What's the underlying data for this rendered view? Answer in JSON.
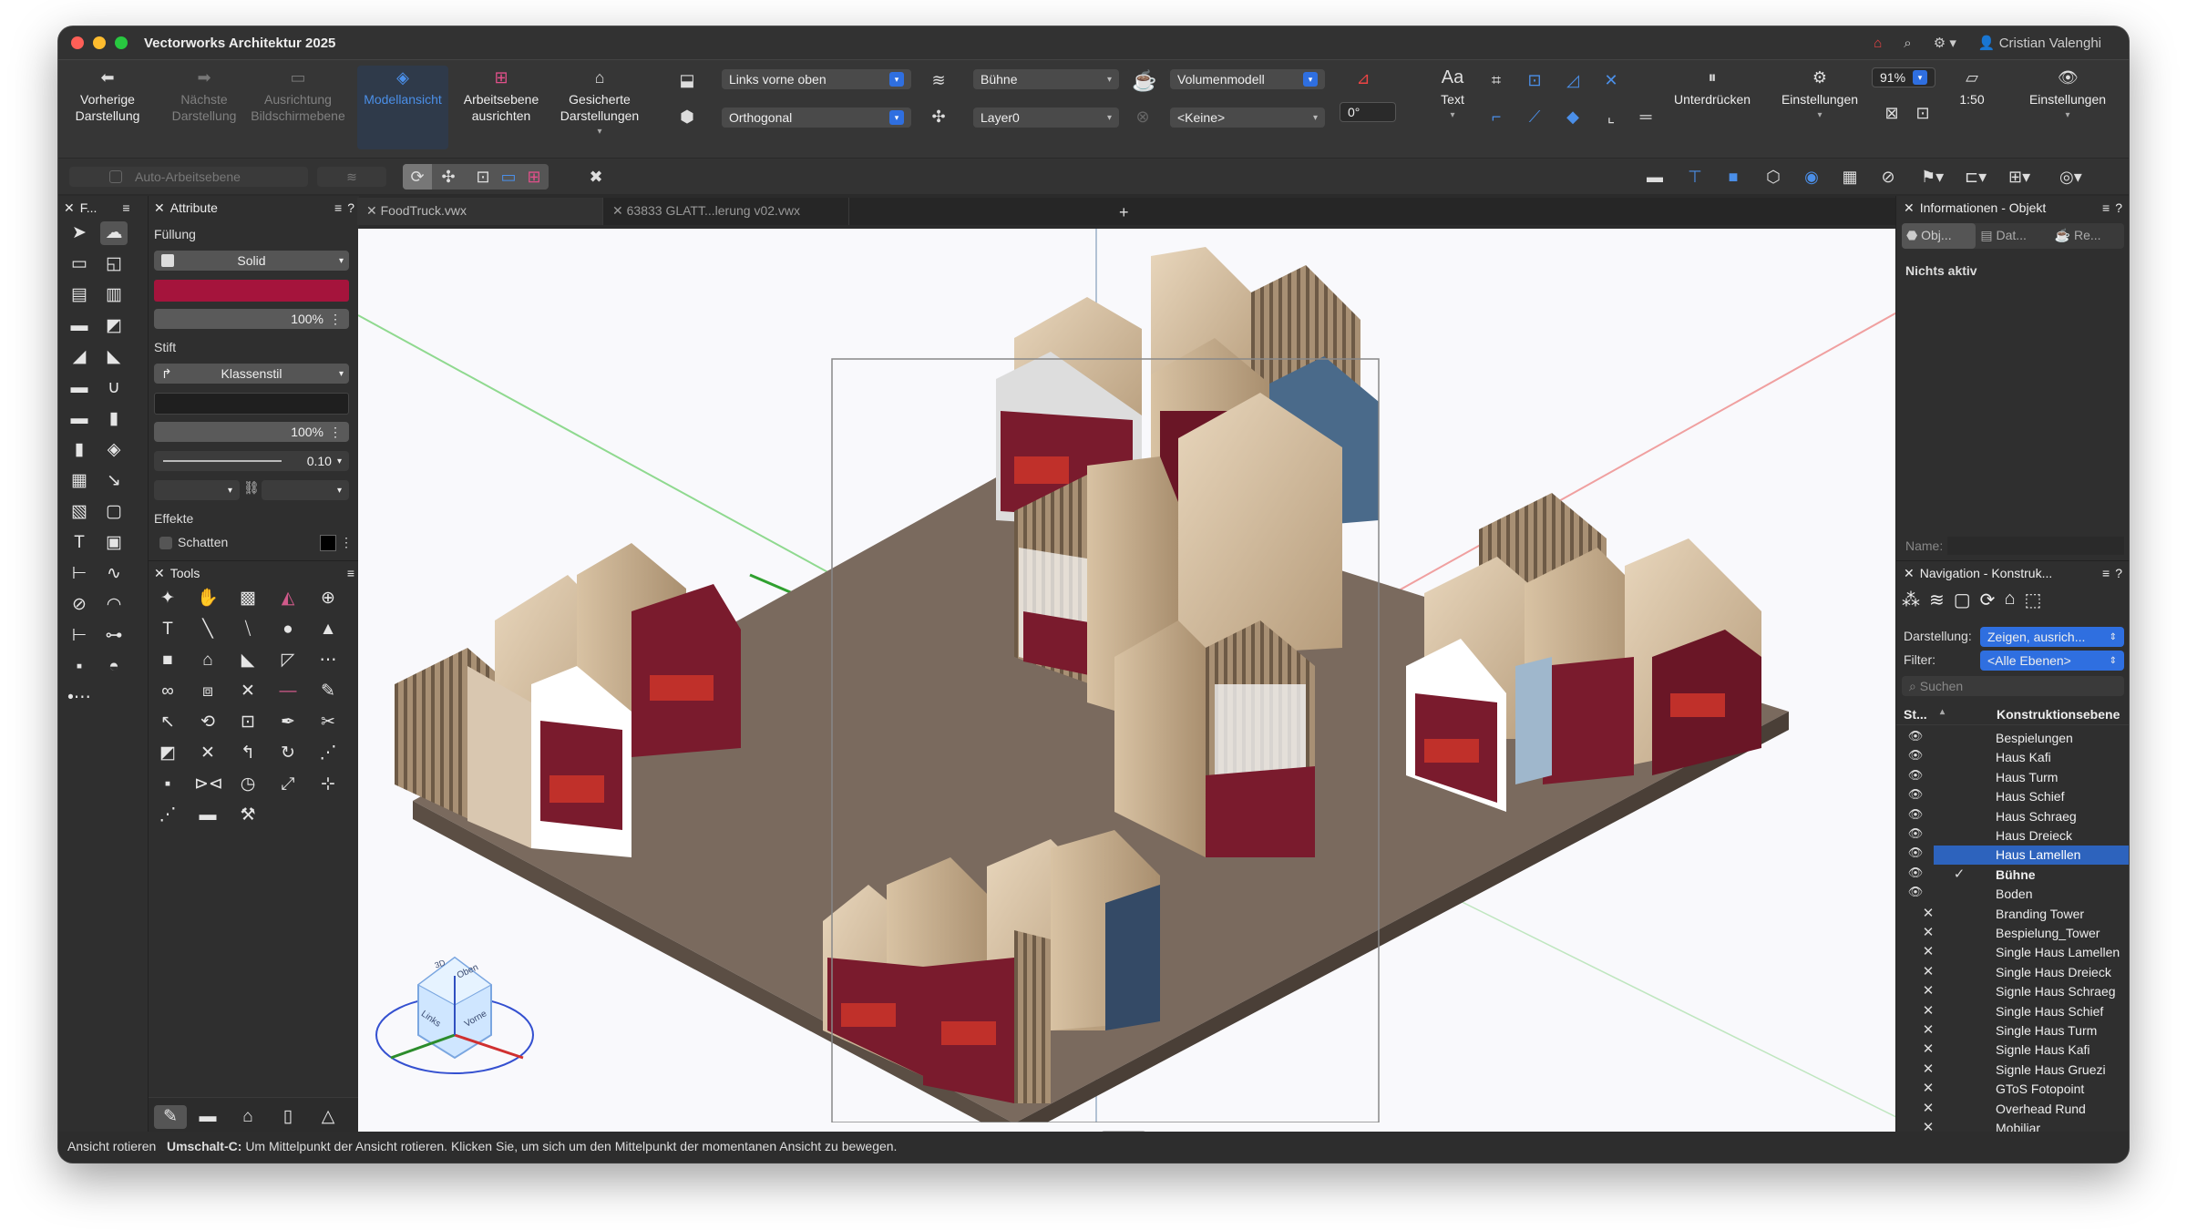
{
  "window": {
    "title": "Vectorworks Architektur 2025",
    "user": "Cristian Valenghi"
  },
  "toolbar": {
    "prev_view": "Vorherige Darstellung",
    "next_view": "Nächste Darstellung",
    "align_plane": "Ausrichtung Bildschirmebene",
    "model_view": "Modellansicht",
    "workplane_align": "Arbeitsebene ausrichten",
    "saved_views": "Gesicherte Darstellungen",
    "view_select": "Links vorne oben",
    "projection_select": "Orthogonal",
    "class_select": "Bühne",
    "layer_select": "Layer0",
    "render_select": "Volumenmodell",
    "plane_select": "<Keine>",
    "angle_value": "0°",
    "text_label": "Aa",
    "text_sub": "Text",
    "suppress": "Unterdrücken",
    "settings": "Einstellungen",
    "zoom": "91%",
    "scale": "1:50",
    "settings2": "Einstellungen"
  },
  "row2": {
    "auto_workplane": "Auto-Arbeitsebene"
  },
  "left_panels": {
    "tools_short": "F...",
    "attributes": {
      "title": "Attribute",
      "fill_label": "Füllung",
      "fill_style": "Solid",
      "fill_color": "#a5143c",
      "fill_opacity": "100%",
      "pen_label": "Stift",
      "pen_style": "Klassenstil",
      "pen_opacity": "100%",
      "pen_weight": "0.10",
      "effects_label": "Effekte",
      "shadow_label": "Schatten"
    },
    "tools_title": "Tools"
  },
  "tabs": [
    "FoodTruck.vwx",
    "63833 GLATT...lerung v02.vwx"
  ],
  "tab_add": "+",
  "right_panels": {
    "info": {
      "title": "Informationen - Objekt",
      "tab_obj": "Obj...",
      "tab_dat": "Dat...",
      "tab_re": "Re...",
      "none_active": "Nichts aktiv",
      "name_label": "Name:"
    },
    "navigation": {
      "title": "Navigation - Konstruk...",
      "view_label": "Darstellung:",
      "view_value": "Zeigen, ausrich...",
      "filter_label": "Filter:",
      "filter_value": "<Alle Ebenen>",
      "search_placeholder": "Suchen",
      "col_status": "St...",
      "col_name": "Konstruktionsebene",
      "layers": [
        {
          "name": "Bespielungen",
          "icon": "eye"
        },
        {
          "name": "Haus Kafi",
          "icon": "eye"
        },
        {
          "name": "Haus Turm",
          "icon": "eye"
        },
        {
          "name": "Haus Schief",
          "icon": "eye"
        },
        {
          "name": "Haus Schraeg",
          "icon": "eye"
        },
        {
          "name": "Haus Dreieck",
          "icon": "eye"
        },
        {
          "name": "Haus Lamellen",
          "icon": "eye",
          "selected": true
        },
        {
          "name": "Bühne",
          "icon": "eye",
          "active": true
        },
        {
          "name": "Boden",
          "icon": "eye"
        },
        {
          "name": "Branding Tower",
          "icon": "hidden"
        },
        {
          "name": "Bespielung_Tower",
          "icon": "hidden"
        },
        {
          "name": "Single Haus Lamellen",
          "icon": "hidden"
        },
        {
          "name": "Single Haus Dreieck",
          "icon": "hidden"
        },
        {
          "name": "Signle Haus Schraeg",
          "icon": "hidden"
        },
        {
          "name": "Single Haus Schief",
          "icon": "hidden"
        },
        {
          "name": "Single Haus Turm",
          "icon": "hidden"
        },
        {
          "name": "Signle Haus Kafi",
          "icon": "hidden"
        },
        {
          "name": "Signle Haus Gruezi",
          "icon": "hidden"
        },
        {
          "name": "GToS Fotopoint",
          "icon": "hidden"
        },
        {
          "name": "Overhead Rund",
          "icon": "hidden"
        },
        {
          "name": "Mobiliar",
          "icon": "hidden"
        }
      ]
    }
  },
  "viewcube": {
    "top": "Oben",
    "left": "Links",
    "front": "Vorne",
    "mode": "3D"
  },
  "status": {
    "tool": "Ansicht rotieren",
    "shortcut": "Umschalt-C:",
    "hint": "Um Mittelpunkt der Ansicht rotieren. Klicken Sie, um sich um den Mittelpunkt der momentanen Ansicht zu bewegen."
  },
  "colors": {
    "accent": "#2f6fe0",
    "selection": "#2d63bd",
    "fill": "#a5143c"
  }
}
